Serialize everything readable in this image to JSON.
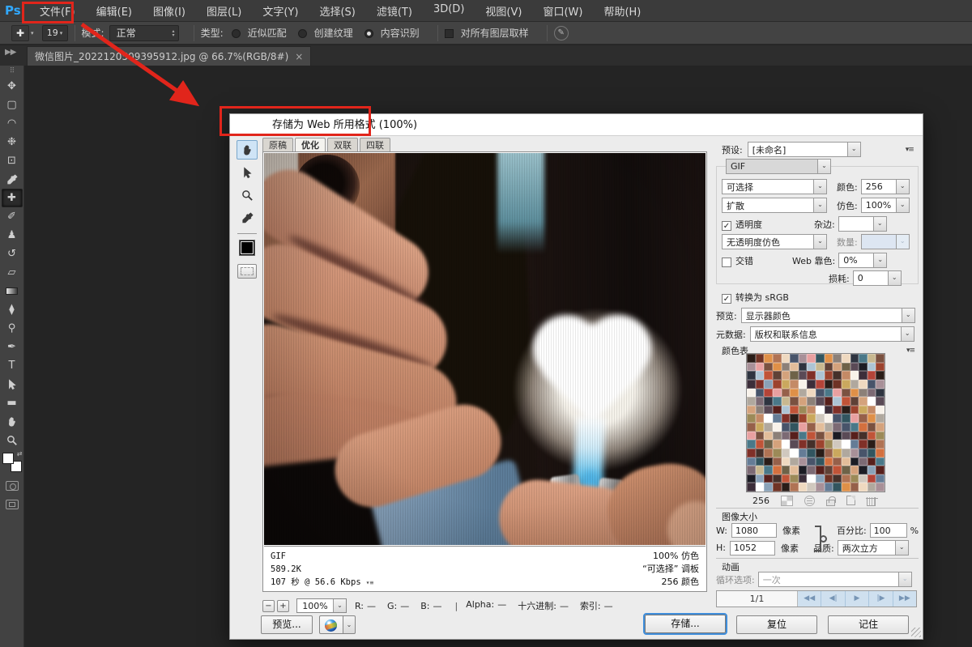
{
  "app": {
    "logo": "Ps",
    "menu": [
      "文件(F)",
      "编辑(E)",
      "图像(I)",
      "图层(L)",
      "文字(Y)",
      "选择(S)",
      "滤镜(T)",
      "3D(D)",
      "视图(V)",
      "窗口(W)",
      "帮助(H)"
    ],
    "panel_collapse": "▶▶",
    "document_tab": {
      "title": "微信图片_2022120509395912.jpg @ 66.7%(RGB/8#)",
      "close": "×"
    }
  },
  "options_bar": {
    "tool_icon": "✚",
    "brush_size": "19",
    "mode_label": "模式:",
    "mode_value": "正常",
    "type_label": "类型:",
    "radios": [
      {
        "label": "近似匹配",
        "selected": false
      },
      {
        "label": "创建纹理",
        "selected": false
      },
      {
        "label": "内容识别",
        "selected": true
      }
    ],
    "sample_all_layers_label": "对所有图层取样"
  },
  "tools": [
    {
      "name": "move-tool",
      "icon": "glyph",
      "glyph": "✥"
    },
    {
      "name": "rectangular-marquee-tool",
      "icon": "glyph",
      "glyph": "▢"
    },
    {
      "name": "lasso-tool",
      "icon": "glyph",
      "glyph": "◠"
    },
    {
      "name": "quick-selection-tool",
      "icon": "glyph",
      "glyph": "❉"
    },
    {
      "name": "crop-tool",
      "icon": "glyph",
      "glyph": "⊡"
    },
    {
      "name": "eyedropper-tool",
      "icon": "svg",
      "svg": "dropper"
    },
    {
      "name": "spot-healing-brush-tool",
      "icon": "glyph",
      "glyph": "✚",
      "selected": true
    },
    {
      "name": "brush-tool",
      "icon": "glyph",
      "glyph": "✐"
    },
    {
      "name": "clone-stamp-tool",
      "icon": "glyph",
      "glyph": "♟"
    },
    {
      "name": "history-brush-tool",
      "icon": "glyph",
      "glyph": "↺"
    },
    {
      "name": "eraser-tool",
      "icon": "glyph",
      "glyph": "▱"
    },
    {
      "name": "gradient-tool",
      "icon": "gradient"
    },
    {
      "name": "blur-tool",
      "icon": "glyph",
      "glyph": "⧫"
    },
    {
      "name": "dodge-tool",
      "icon": "glyph",
      "glyph": "⚲"
    },
    {
      "name": "pen-tool",
      "icon": "glyph",
      "glyph": "✒"
    },
    {
      "name": "type-tool",
      "icon": "glyph",
      "glyph": "T"
    },
    {
      "name": "path-selection-tool",
      "icon": "svg",
      "svg": "cursor"
    },
    {
      "name": "shape-tool",
      "icon": "glyph",
      "glyph": "▬"
    },
    {
      "name": "hand-tool",
      "icon": "svg",
      "svg": "hand"
    },
    {
      "name": "zoom-tool",
      "icon": "svg",
      "svg": "magnifier"
    }
  ],
  "dialog": {
    "title": "存储为 Web 所用格式 (100%)",
    "preview_tabs": [
      "原稿",
      "优化",
      "双联",
      "四联"
    ],
    "active_tab": "优化",
    "photo_description": "hands lighting a heart-shaped flame with lighters in a dark room",
    "status_left": [
      "GIF",
      "589.2K",
      "107 秒 @ 56.6 Kbps"
    ],
    "status_right": [
      "100% 仿色",
      "“可选择” 调板",
      "256 颜色"
    ],
    "zoom": {
      "minus": "−",
      "plus": "+",
      "value": "100%"
    },
    "readout_rgb": [
      {
        "label": "R:",
        "value": "—"
      },
      {
        "label": "G:",
        "value": "—"
      },
      {
        "label": "B:",
        "value": "—"
      }
    ],
    "readout_extra": [
      {
        "label": "Alpha:",
        "value": "—"
      },
      {
        "label": "十六进制:",
        "value": "—"
      },
      {
        "label": "索引:",
        "value": "—"
      }
    ],
    "buttons": {
      "preview": "预览...",
      "save": "存储...",
      "reset": "复位",
      "remember": "记住"
    },
    "settings": {
      "preset_label": "预设:",
      "preset_value": "[未命名]",
      "format_value": "GIF",
      "palette_value": "可选择",
      "colors_label": "颜色:",
      "colors_value": "256",
      "dither_method_value": "扩散",
      "dither_label": "仿色:",
      "dither_value": "100%",
      "transparency_label": "透明度",
      "transparency_checked": "✓",
      "matte_label": "杂边:",
      "matte_value": "",
      "trans_dither_value": "无透明度仿色",
      "amount_label": "数量:",
      "amount_value": "",
      "interlace_label": "交错",
      "websnap_label": "Web 靠色:",
      "websnap_value": "0%",
      "lossy_label": "损耗:",
      "lossy_value": "0",
      "srgb_label": "转换为 sRGB",
      "srgb_checked": "✓",
      "preview_label": "预览:",
      "preview_value": "显示器颜色",
      "metadata_label": "元数据:",
      "metadata_value": "版权和联系信息"
    },
    "color_table": {
      "label": "颜色表",
      "count": "256",
      "base_colors": [
        "#2a1d18",
        "#45302a",
        "#5f4136",
        "#7a5140",
        "#96604a",
        "#b07354",
        "#c48a66",
        "#d4a27c",
        "#e2bd9a",
        "#efd9c0",
        "#f8f2ea",
        "#ffffff",
        "#1c1c24",
        "#2e3440",
        "#48546a",
        "#657c96",
        "#8aa2b8",
        "#adc4d4",
        "#4a7888",
        "#32555f",
        "#6f3325",
        "#9c432e",
        "#c05438",
        "#d3703f",
        "#df9048",
        "#caa85e",
        "#9c8a58",
        "#6e6248",
        "#8c8078",
        "#b0a89e",
        "#d0c8be",
        "#3c2e3a",
        "#5a4a56",
        "#7c6a74",
        "#a89098",
        "#b34438",
        "#803028",
        "#57201c",
        "#c8b890",
        "#e8a0a0"
      ]
    },
    "image_size": {
      "label": "图像大小",
      "w_label": "W:",
      "w_value": "1080",
      "h_label": "H:",
      "h_value": "1052",
      "px_label": "像素",
      "percent_label": "百分比:",
      "percent_value": "100",
      "percent_unit": "%",
      "quality_label": "品质:",
      "quality_value": "两次立方"
    },
    "animation": {
      "label": "动画",
      "loop_label": "循环选项:",
      "loop_value": "一次",
      "frame": "1/1",
      "playback": [
        "◀◀",
        "◀|",
        "▶",
        "|▶",
        "▶▶"
      ]
    }
  },
  "annotation_color": "#e1251b"
}
